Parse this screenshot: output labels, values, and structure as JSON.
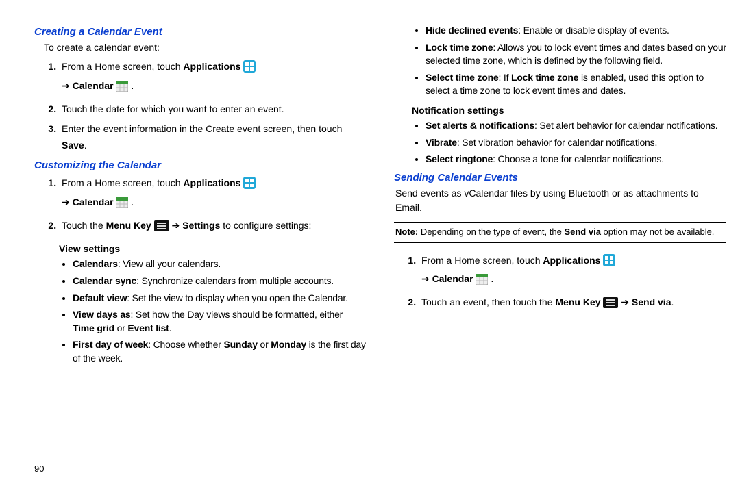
{
  "pageNumber": "90",
  "left": {
    "sec1": {
      "title": "Creating a Calendar Event",
      "intro": "To create a calendar event:"
    },
    "step_touch": "Touch the date for which you want to enter an event.",
    "step_enter": "Enter the event information in the Create event screen, then touch ",
    "save": "Save",
    "sec2": {
      "title": "Customizing the Calendar"
    },
    "settings": "Settings",
    "toconfig": " to configure settings:",
    "viewSettings": "View settings",
    "vs": {
      "calendars_b": "Calendars",
      "calendars_t": ": View all your calendars.",
      "sync_b": "Calendar sync",
      "sync_t": ": Synchronize calendars from multiple accounts.",
      "default_b": "Default view",
      "default_t": ": Set the view to display when you open the Calendar.",
      "viewdays_b": "View days as",
      "viewdays_t1": ": Set how the Day views should be formatted, either ",
      "timegrid": "Time grid",
      "or": " or ",
      "eventlist": "Event list",
      "dot": ".",
      "firstday_b": "First day of week",
      "firstday_t1": ": Choose whether ",
      "sunday": "Sunday",
      "monday": "Monday",
      "firstday_t2": " is the first day of the week."
    }
  },
  "right": {
    "vs2": {
      "hide_b": "Hide declined events",
      "hide_t": ": Enable or disable display of events.",
      "lock_b": "Lock time zone",
      "lock_t": ": Allows you to lock event times and dates based on your selected time zone, which is defined by the following field.",
      "sel_b": "Select time zone",
      "sel_t1": ": If ",
      "lock_i": "Lock time zone",
      "sel_t2": " is enabled, used this option to select a time zone to lock event times and dates."
    },
    "notif": "Notification settings",
    "ns": {
      "alerts_b": "Set alerts & notifications",
      "alerts_t": ": Set alert behavior for calendar notifications.",
      "vib_b": "Vibrate",
      "vib_t": ": Set vibration behavior for calendar notifications.",
      "ring_b": "Select ringtone",
      "ring_t": ": Choose a tone for calendar notifications."
    },
    "sec3": {
      "title": "Sending Calendar Events",
      "intro": "Send events as vCalendar files by using Bluetooth or as attachments to Email."
    },
    "note_b": "Note: ",
    "note_t1": "Depending on the type of event, the ",
    "sendvia": "Send via",
    "note_t2": " option may not be available.",
    "step_touchevent": "Touch an event, then touch the "
  },
  "common": {
    "fromhome": "From a Home screen, touch ",
    "applications": "Applications",
    "arrow": "➔ ",
    "calendar": "Calendar",
    "menukey": "Menu Key",
    "touchthe": "Touch the "
  }
}
